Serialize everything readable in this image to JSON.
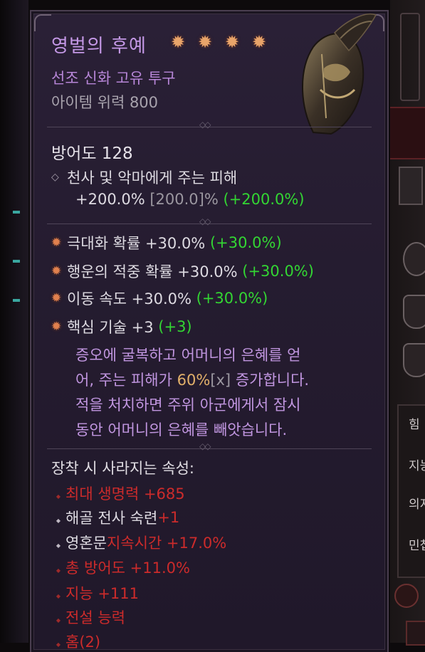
{
  "item": {
    "name": "영벌의 후예",
    "type": "선조 신화 고유 투구",
    "power": "아이템 위력 800",
    "stars": 4,
    "armor": "방어도 128",
    "implicit": {
      "line1": "천사 및 악마에게 주는 피해",
      "line2_value": "+200.0%",
      "line2_range": "[200.0]%",
      "line2_bonus": "(+200.0%)"
    },
    "affixes": [
      {
        "label": "극대화 확률 +30.0%",
        "bonus": "(+30.0%)"
      },
      {
        "label": "행운의 적중 확률 +30.0%",
        "bonus": "(+30.0%)"
      },
      {
        "label": "이동 속도 +30.0%",
        "bonus": "(+30.0%)"
      },
      {
        "label": "핵심 기술 +3",
        "bonus": "(+3)"
      }
    ],
    "unique_power": {
      "text1": "증오에 굴복하고 어머니의 은혜를 얻",
      "text2a": "어, 주는 피해가 ",
      "text2_value": "60%",
      "text2_range": "[x]",
      "text2b": " 증가합니다.",
      "text3": "적을 처치하면 주위 아군에게서 잠시",
      "text4": "동안 어머니의 은혜를 빼앗습니다."
    },
    "lost_section": {
      "title": "장착 시 사라지는 속성:",
      "items": [
        {
          "text": "최대 생명력 +685"
        },
        {
          "text_white": "해골 전사 숙련 ",
          "text_red": "+1"
        },
        {
          "text_white": "영혼문 ",
          "text_red": "지속시간 +17.0%"
        },
        {
          "text": "총 방어도 +11.0%"
        },
        {
          "text": "지능 +111"
        },
        {
          "text": "전설 능력"
        },
        {
          "text": "홈(2)"
        }
      ]
    }
  },
  "right_panel": {
    "labels": [
      "힘",
      "지능",
      "의지",
      "민첩"
    ]
  }
}
